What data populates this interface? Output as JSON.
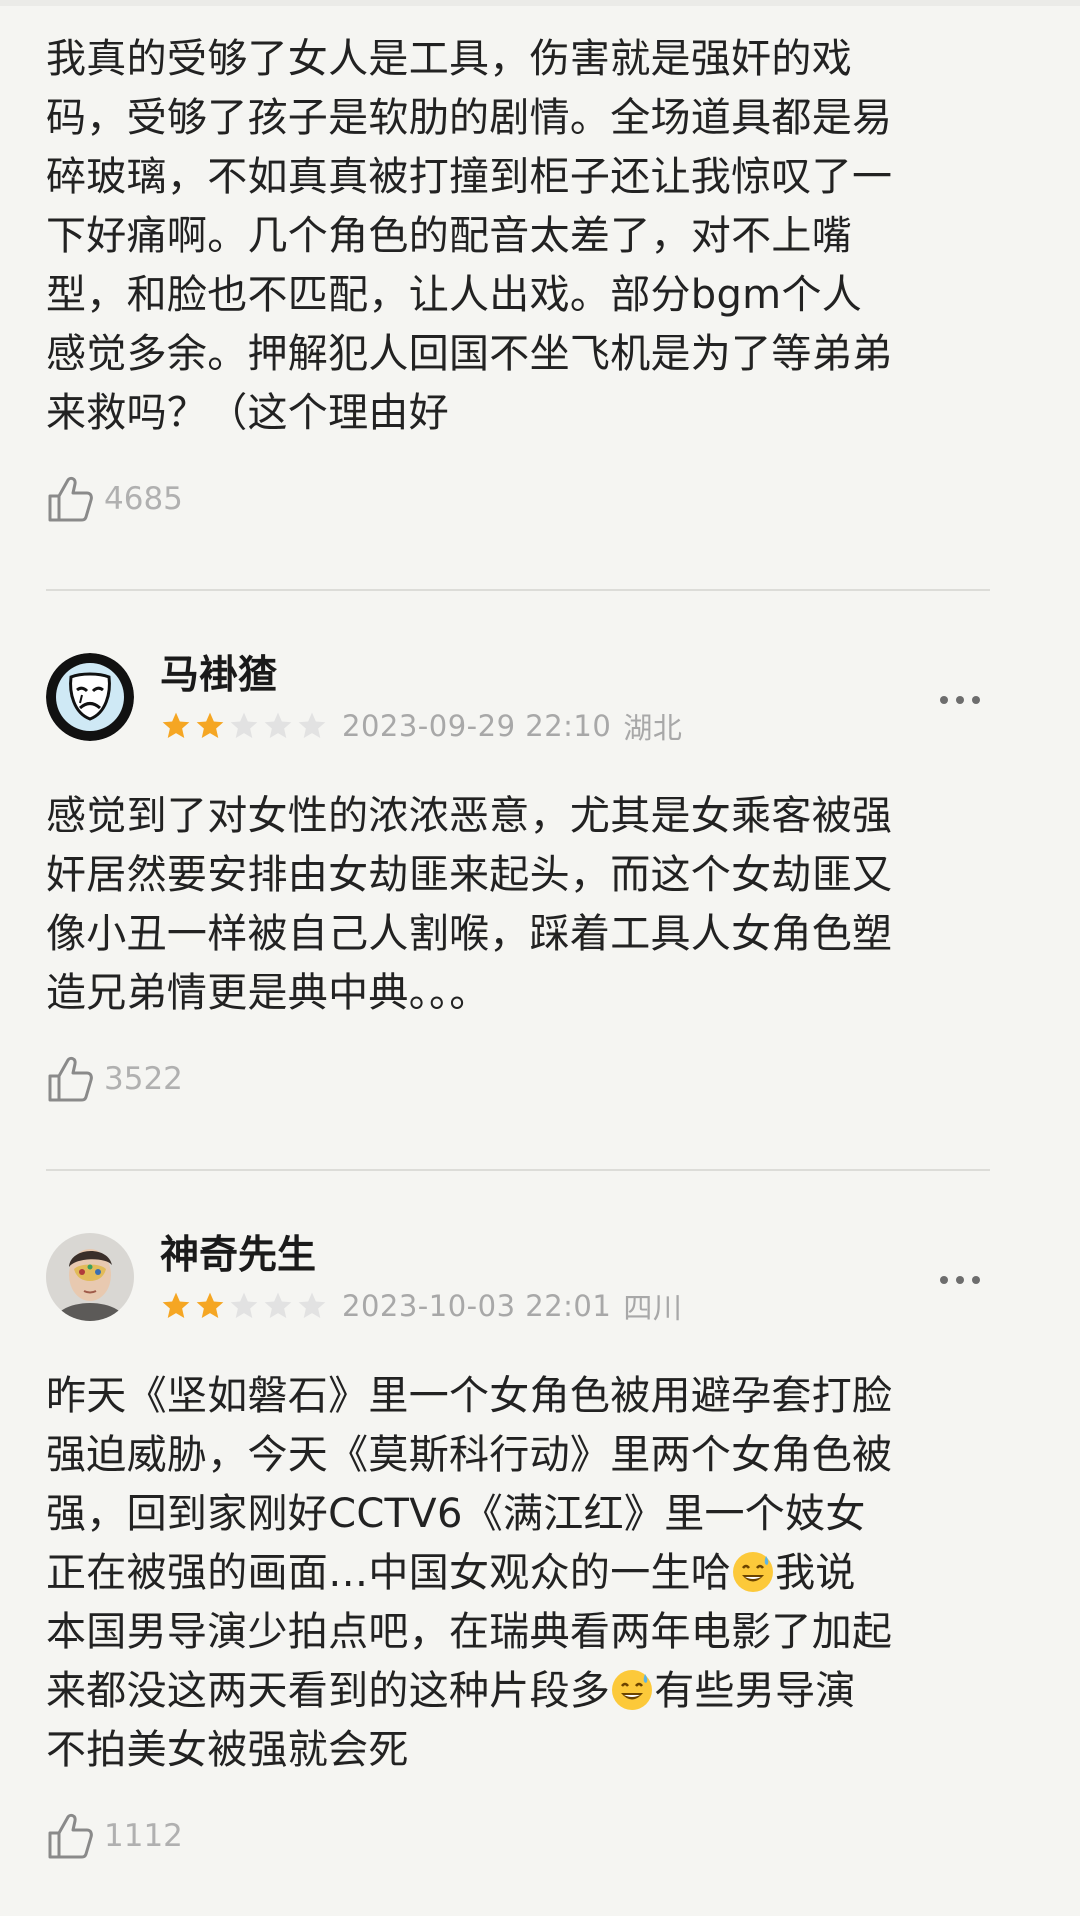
{
  "reviews": [
    {
      "body": "我真的受够了女人是工具，伤害就是强奸的戏\n码，受够了孩子是软肋的剧情。全场道具都是易\n碎玻璃，不如真真被打撞到柜子还让我惊叹了一\n下好痛啊。几个角色的配音太差了，对不上嘴\n型，和脸也不匹配，让人出戏。部分bgm个人\n感觉多余。押解犯人回国不坐飞机是为了等弟弟\n来救吗？（这个理由好",
      "likes": "4685"
    },
    {
      "username": "马褂猹",
      "rating": 2,
      "rating_max": 5,
      "timestamp": "2023-09-29 22:10",
      "location": "湖北",
      "avatar_icon": "sad-mask-icon",
      "body": "感觉到了对女性的浓浓恶意，尤其是女乘客被强\n奸居然要安排由女劫匪来起头，而这个女劫匪又\n像小丑一样被自己人割喉，踩着工具人女角色塑\n造兄弟情更是典中典。。。",
      "likes": "3522"
    },
    {
      "username": "神奇先生",
      "rating": 2,
      "rating_max": 5,
      "timestamp": "2023-10-03 22:01",
      "location": "四川",
      "avatar_icon": "photo-avatar",
      "body_parts": [
        "昨天《坚如磐石》里一个女角色被用避孕套打脸\n强迫威胁，今天《莫斯科行动》里两个女角色被\n强，回到家刚好CCTV6《满江红》里一个妓女\n正在被强的画面…中国女观众的一生哈",
        "我说\n本国男导演少拍点吧，在瑞典看两年电影了加起\n来都没这两天看到的这种片段多",
        "有些男导演\n不拍美女被强就会死"
      ],
      "emoji": "sweat-smile-emoji",
      "likes": "1112"
    }
  ],
  "icons": {
    "like": "thumbs-up-icon",
    "more": "more-dots-icon",
    "star_filled": "star-filled-icon",
    "star_empty": "star-empty-icon"
  },
  "colors": {
    "star_filled": "#f5a623",
    "star_empty": "#e2e2e2",
    "meta": "#a8a8a8",
    "background": "#f5f5f2"
  }
}
